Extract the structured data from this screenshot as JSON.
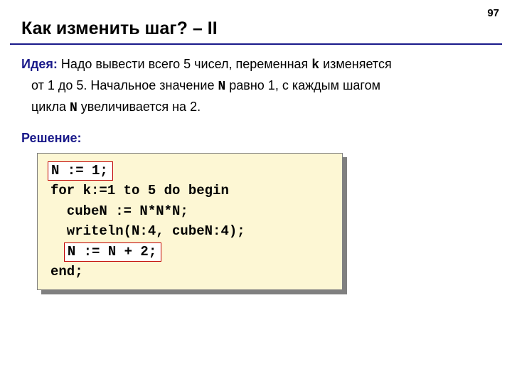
{
  "page_number": "97",
  "title": "Как изменить шаг? – II",
  "idea": {
    "label": "Идея:",
    "pre_k": " Надо вывести всего 5 чисел, переменная ",
    "k": "k",
    "post_k": " изменяется",
    "line2_pre": "от 1 до 5. Начальное значение ",
    "n1": "N",
    "line2_mid": " равно 1, с каждым шагом",
    "line3_pre": "цикла ",
    "n2": "N",
    "line3_post": " увеличивается на 2."
  },
  "solution_label": "Решение:",
  "code": {
    "l1": "N := 1;",
    "l2": "for k:=1 to 5 do begin",
    "l3": "  cubeN := N*N*N;",
    "l4": "  writeln(N:4, cubeN:4);",
    "l5_indent": "  ",
    "l5": "N := N + 2;",
    "l6": "end;"
  }
}
